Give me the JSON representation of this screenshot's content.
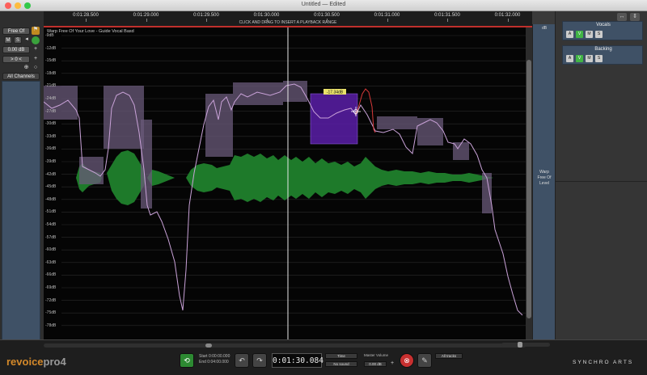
{
  "window": {
    "title": "Untitled — Edited"
  },
  "ruler": {
    "ticks": [
      "0:01:28.500",
      "0:01:29.000",
      "0:01:29.500",
      "0:01:30.000",
      "0:01:30.500",
      "0:01:31.000",
      "0:01:31.500",
      "0:01:32.000"
    ],
    "hint": "CLICK AND DRAG TO INSERT A PLAYBACK RANGE"
  },
  "left": {
    "mode": "Free Of",
    "mute": "M",
    "solo": "S",
    "gain": "0.00 dB",
    "offset": "> 0 <",
    "channels": "All Channels"
  },
  "plot": {
    "track_name": "Warp Free Of Your Love - Guide Vocal Basd",
    "db_labels": [
      "-9dB",
      "-12dB",
      "-15dB",
      "-18dB",
      "-21dB",
      "-24dB",
      "-27dB",
      "-30dB",
      "-33dB",
      "-36dB",
      "-39dB",
      "-42dB",
      "-45dB",
      "-48dB",
      "-51dB",
      "-54dB",
      "-57dB",
      "-60dB",
      "-63dB",
      "-66dB",
      "-69dB",
      "-72dB",
      "-75dB",
      "-78dB"
    ],
    "selection_value": "-17.34dB",
    "colors": {
      "waveform": "#1e7a2a",
      "curve": "#c9a2d8",
      "block": "#6a5a7a",
      "selection": "#5a1fa8",
      "new_curve": "#d83a3a"
    }
  },
  "warp": {
    "db": "dB",
    "text": [
      "Warp",
      "Free Of",
      "Level"
    ]
  },
  "tracks": [
    {
      "name": "Vocals",
      "buttons": [
        "A",
        "V",
        "M",
        "S"
      ]
    },
    {
      "name": "Backing",
      "buttons": [
        "A",
        "V",
        "M",
        "S"
      ]
    }
  ],
  "transport": {
    "logo_a": "revoice",
    "logo_b": "pro4",
    "start_label": "Start",
    "start_value": "0:00:00.000",
    "end_label": "End",
    "end_value": "0:04:00.000",
    "time": "0:01:30.084",
    "time_mode": "Time",
    "no_sound": "No sound",
    "master_label": "Master Volume",
    "master_value": "0.00 dB",
    "all_tracks": "All tracks",
    "brand": "SYNCHRO ARTS"
  }
}
